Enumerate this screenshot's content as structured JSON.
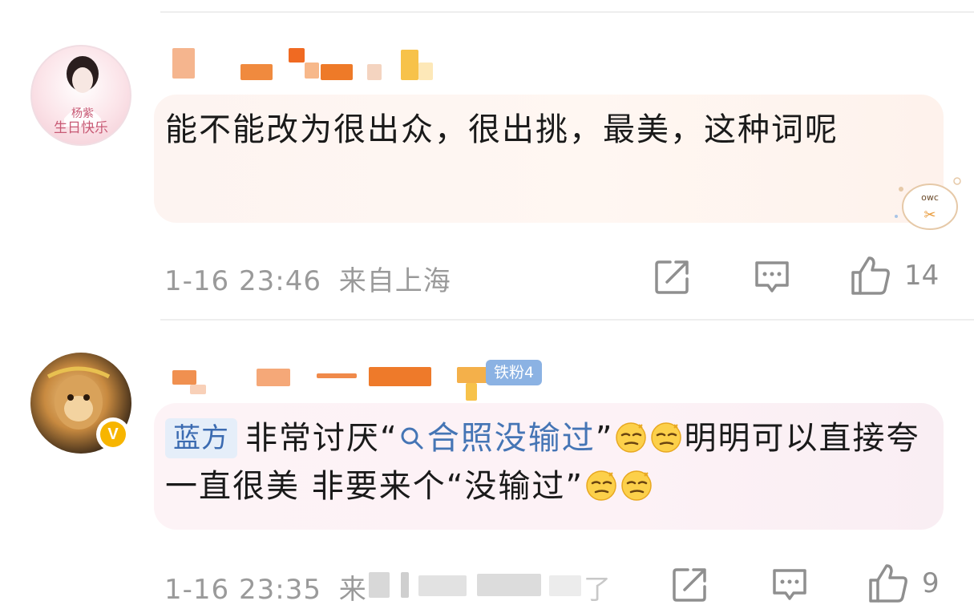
{
  "comments": [
    {
      "text": "能不能改为很出众，很出挑，最美，这种词呢",
      "time": "1-16 23:46",
      "location": "来自上海",
      "likes": "14",
      "avatar_caption": "生日快乐",
      "actions": {
        "share_icon": "share-icon",
        "reply_icon": "comment-icon",
        "like_icon": "thumb-up-icon"
      }
    },
    {
      "tag": "蓝方",
      "text_before": "非常讨厌“",
      "link_text": "合照没输过",
      "text_after": "”",
      "text_line": "明明可以直接夸一直很美 非要来个“没输过”",
      "fan_badge": "铁粉4",
      "verified_badge": "V",
      "time": "1-16 23:35",
      "location_partial": "来",
      "location_tail": "了",
      "likes": "9",
      "actions": {
        "share_icon": "share-icon",
        "reply_icon": "comment-icon",
        "like_icon": "thumb-up-icon"
      }
    }
  ],
  "colors": {
    "accent_blue": "#4575b5",
    "meta_gray": "#9a9a9a",
    "verified_gold": "#f7b500",
    "fan_badge_bg": "#8bb2e3"
  }
}
